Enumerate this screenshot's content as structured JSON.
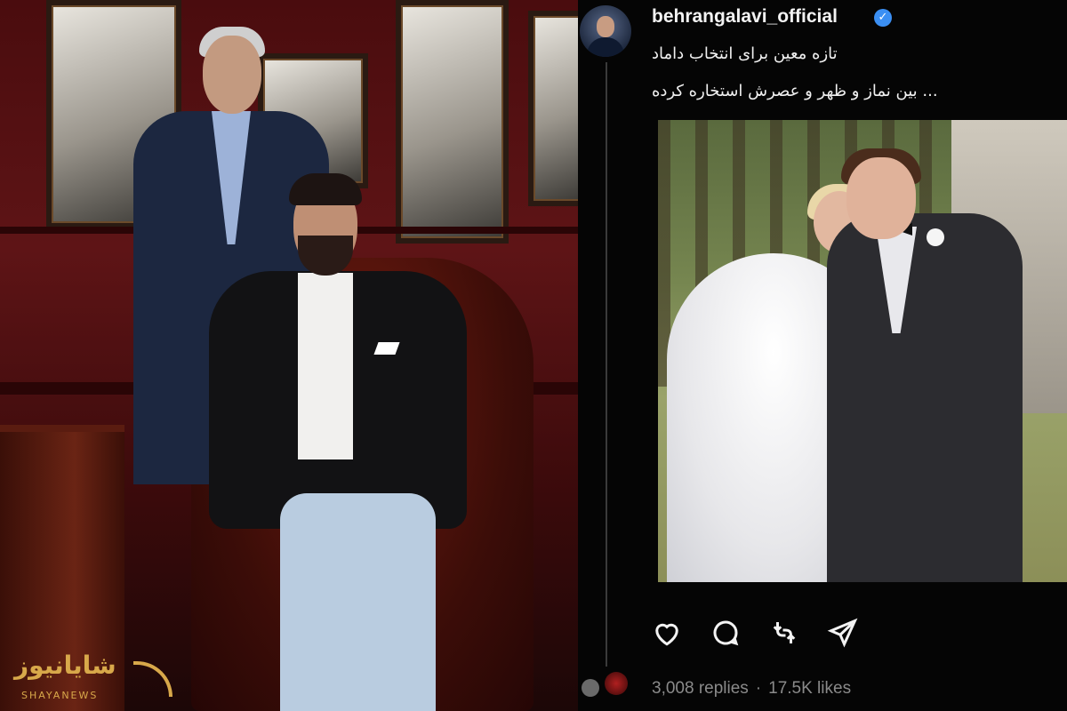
{
  "left_photo": {
    "watermark": {
      "brand_text": "شایانیوز",
      "brand_latin": "SHAYANEWS",
      "color": "#d8a84a"
    }
  },
  "post": {
    "username": "behrangalavi_official",
    "verified_icon": "verified-badge-icon",
    "caption_lines": [
      "تازه معین برای انتخاب داماد",
      "... بین نماز و ظهر و عصرش استخاره کرده"
    ],
    "actions": [
      {
        "name": "like-icon"
      },
      {
        "name": "comment-icon"
      },
      {
        "name": "repost-icon"
      },
      {
        "name": "share-icon"
      }
    ],
    "stats": {
      "replies": "3,008 replies",
      "separator": "·",
      "likes": "17.5K likes"
    }
  },
  "colors": {
    "background": "#050505",
    "text": "#f3f3f3",
    "muted": "#8a8a8a",
    "verified": "#3b8ff3"
  }
}
